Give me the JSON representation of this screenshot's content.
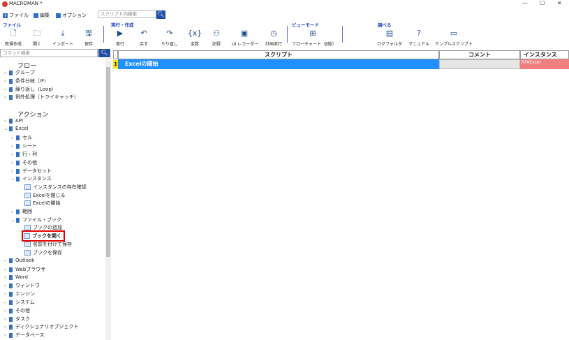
{
  "window": {
    "title": "MACROMAN *",
    "min": "—",
    "max": "☐",
    "close": "✕"
  },
  "menu": {
    "file": "ファイル",
    "edit": "編集",
    "options": "オプション"
  },
  "top_search": {
    "placeholder": "スクリプト内検索"
  },
  "ribbon": {
    "groups": {
      "file": "ファイル",
      "run": "実行・作成",
      "view": "ビューモード",
      "learn": "調べる"
    },
    "buttons": {
      "new": "新規作成",
      "open": "開く",
      "import": "インポート",
      "save": "保存",
      "run": "実行",
      "undo": "戻す",
      "redo": "やり直し",
      "variable": "変数",
      "record": "記録",
      "ui_recorder": "UI レコーダー",
      "schedule": "計画実行",
      "flowchart": "フローチャート（β版）",
      "log": "ログフォルダ",
      "manual": "マニュアル",
      "sample": "サンプルスクリプト"
    }
  },
  "cmd_search": {
    "placeholder": "コマンド検索"
  },
  "tree": {
    "flow_head": "フロー",
    "flow_items": [
      "グループ",
      "条件分岐（IF）",
      "繰り返し（Loop）",
      "例外処理（トライキャッチ）"
    ],
    "action_head": "アクション",
    "api": "API",
    "excel": "Excel",
    "excel_children": [
      "セル",
      "シート",
      "行・列",
      "その他",
      "データセット"
    ],
    "instance": "インスタンス",
    "instance_children": [
      "インスタンスの存在確認",
      "Excelを閉じる",
      "Excelの開始"
    ],
    "range": "範囲",
    "filebook": "ファイル・ブック",
    "filebook_children": [
      "ブックの追加",
      "ブックを開く",
      "名前を付けて保存",
      "ブックを保存"
    ],
    "others": [
      "Outlook",
      "Webブラウザ",
      "Word",
      "ウィンドウ",
      "エンジン",
      "システム",
      "その他",
      "タスク",
      "ディクショナリオブジェクト",
      "データベース"
    ]
  },
  "table": {
    "headers": {
      "script": "スクリプト",
      "comment": "コメント",
      "instance": "インスタンス"
    },
    "rows": [
      {
        "num": "1",
        "script": "Excelの開始",
        "comment": "",
        "instance": "RPAExcel"
      }
    ]
  }
}
